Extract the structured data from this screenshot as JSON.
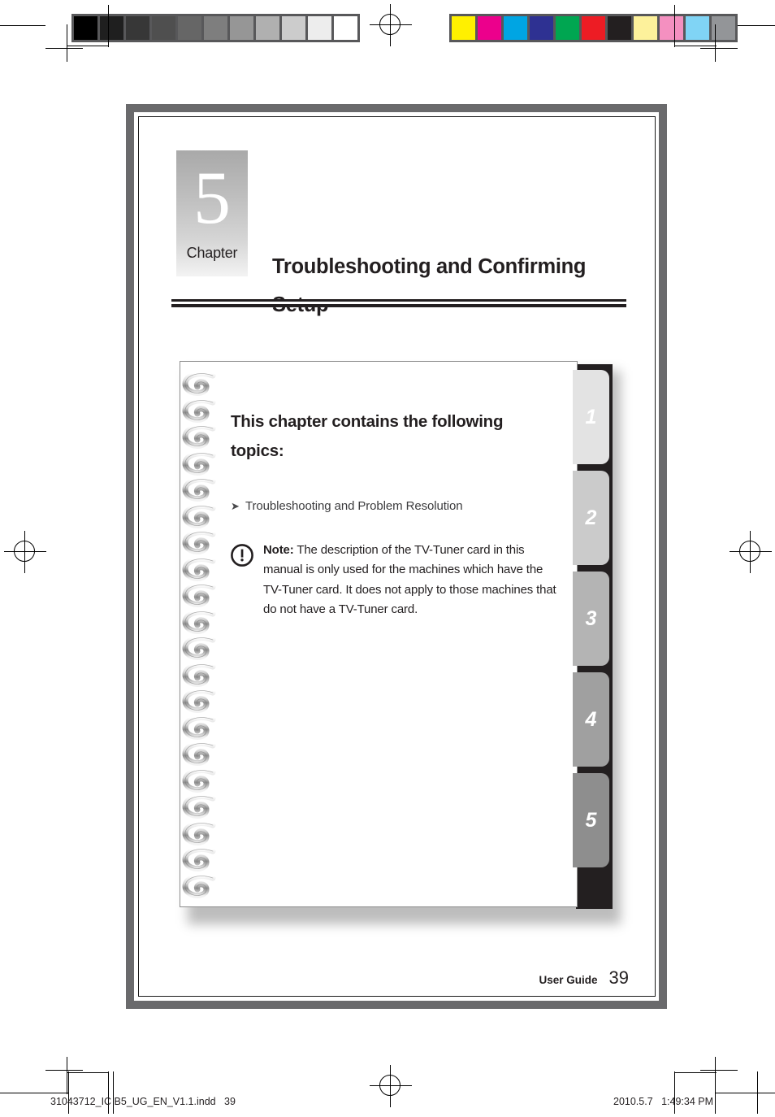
{
  "document": {
    "kind": "printed-manual-page",
    "page_number_footer": "39",
    "footer_label": "User Guide"
  },
  "chapter": {
    "number": "5",
    "word": "Chapter",
    "title": "Troubleshooting and Confirming Setup"
  },
  "notebook": {
    "heading": "This chapter contains the following topics:",
    "topics": [
      {
        "arrow": "➤",
        "label": "Troubleshooting and Problem Resolution"
      }
    ],
    "note": {
      "icon_name": "exclamation-circle-icon",
      "label": "Note:",
      "text": " The description of the TV-Tuner card in this manual is only used for the machines which have the TV-Tuner card. It does not apply to those machines that do not have a TV-Tuner card."
    },
    "tabs": [
      {
        "label": "1",
        "color": "#e3e3e3"
      },
      {
        "label": "2",
        "color": "#cbcbcb"
      },
      {
        "label": "3",
        "color": "#b4b4b4"
      },
      {
        "label": "4",
        "color": "#a0a0a0"
      },
      {
        "label": "5",
        "color": "#8e8e8e"
      }
    ],
    "spine_color": "#231f20"
  },
  "print_marks": {
    "gray_strip": {
      "name": "grayscale-calibration-strip",
      "swatches": [
        "#000000",
        "#1f1f1f",
        "#373737",
        "#4f4f4f",
        "#666666",
        "#7e7e7e",
        "#969696",
        "#b0b0b0",
        "#cccccc",
        "#ededed",
        "#ffffff"
      ]
    },
    "color_strip": {
      "name": "color-calibration-strip",
      "swatches": [
        "#fff000",
        "#ec008c",
        "#00a5e3",
        "#2e3192",
        "#00a651",
        "#ed1c24",
        "#231f20",
        "#fdf19b",
        "#f490c0",
        "#80d4f5",
        "#939598"
      ]
    },
    "registration_mark_name": "registration-crosshair"
  },
  "slug": {
    "filename": "31043712_IC B5_UG_EN_V1.1.indd",
    "page": "39",
    "date": "2010.5.7",
    "time": "1:49:34 PM"
  }
}
